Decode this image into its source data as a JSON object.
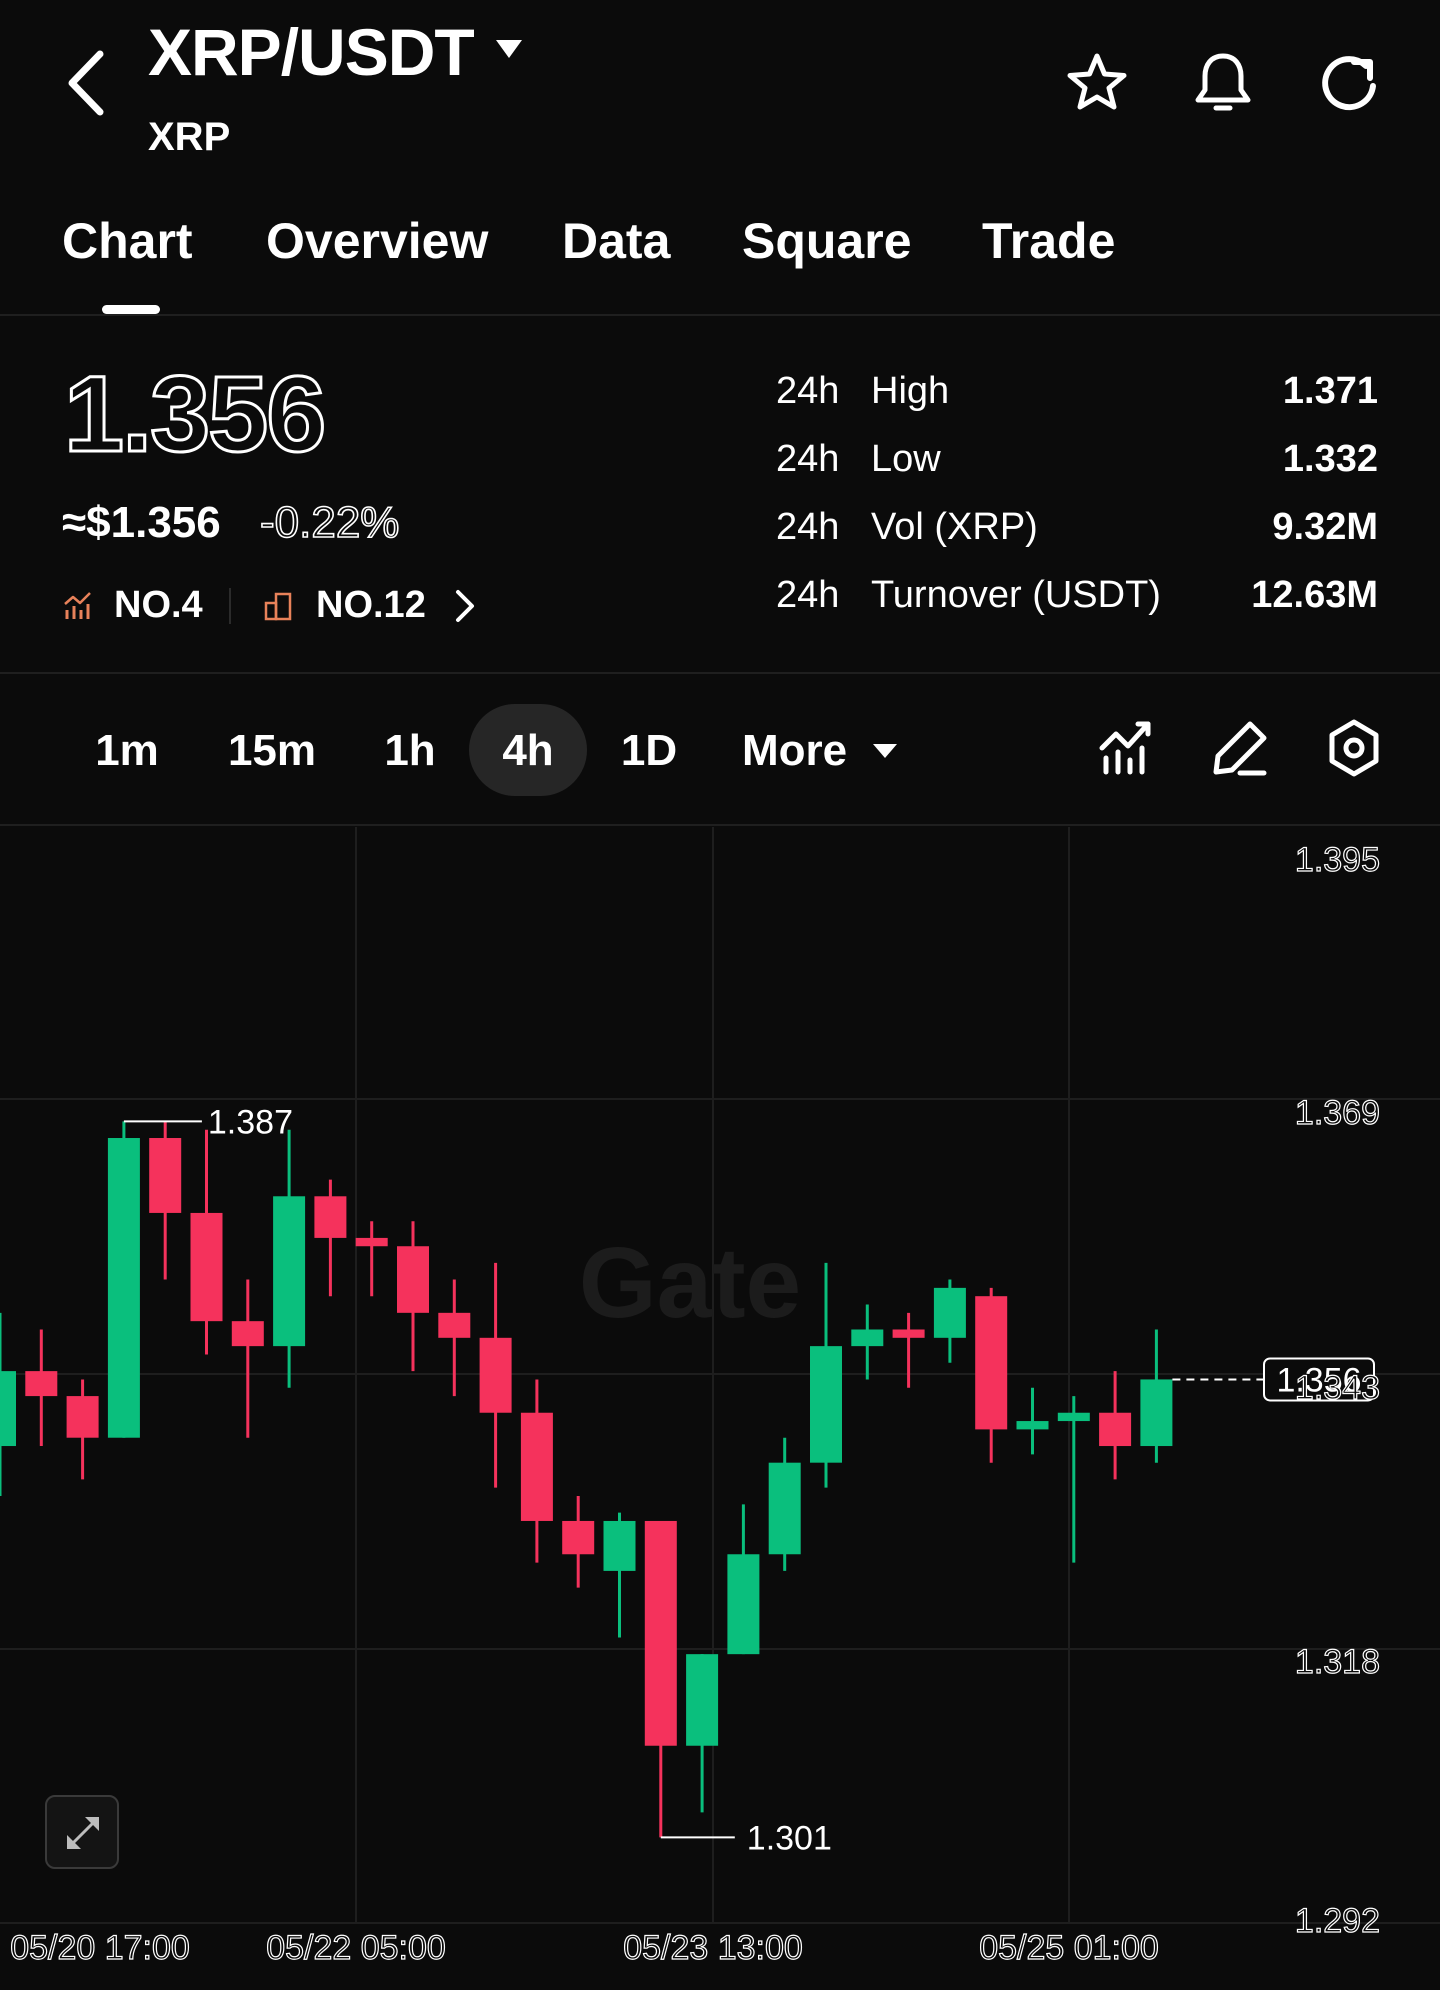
{
  "header": {
    "title": "XRP/USDT",
    "subtitle": "XRP",
    "icons": [
      "back-icon",
      "chevron-down-icon",
      "star-icon",
      "bell-icon",
      "refresh-icon"
    ]
  },
  "tabs": [
    {
      "label": "Chart",
      "active": true
    },
    {
      "label": "Overview",
      "active": false
    },
    {
      "label": "Data",
      "active": false
    },
    {
      "label": "Square",
      "active": false
    },
    {
      "label": "Trade",
      "active": false
    }
  ],
  "price": {
    "last": "1.356",
    "usd": "≈$1.356",
    "change": "-0.22%",
    "rank_market_cap": "NO.4",
    "rank_volume": "NO.12"
  },
  "stats": [
    {
      "period": "24h",
      "label": "High",
      "value": "1.371"
    },
    {
      "period": "24h",
      "label": "Low",
      "value": "1.332"
    },
    {
      "period": "24h",
      "label": "Vol (XRP)",
      "value": "9.32M"
    },
    {
      "period": "24h",
      "label": "Turnover (USDT)",
      "value": "12.63M"
    }
  ],
  "intervals": {
    "items": [
      "1m",
      "15m",
      "1h",
      "4h",
      "1D"
    ],
    "selected": "4h",
    "more_label": "More"
  },
  "toolbar_icons": [
    "indicators-icon",
    "draw-icon",
    "settings-icon"
  ],
  "colors": {
    "background": "#0b0b0b",
    "up": "#0abf7d",
    "down": "#f5325c",
    "text": "#ffffff",
    "grid": "#1e1e1e"
  },
  "chart_data": {
    "type": "candlestick",
    "interval": "4h",
    "watermark": "Gate",
    "y_ticks": [
      "1.395",
      "1.369",
      "1.343",
      "1.318",
      "1.292"
    ],
    "ylim": [
      1.292,
      1.395
    ],
    "x_ticks": [
      "05/20 17:00",
      "05/22 05:00",
      "05/23 13:00",
      "05/25 01:00"
    ],
    "max_label": "1.387",
    "min_label": "1.301",
    "last_price_label": "1.356",
    "candles": [
      {
        "o": 1.348,
        "h": 1.364,
        "l": 1.342,
        "c": 1.357
      },
      {
        "o": 1.357,
        "h": 1.362,
        "l": 1.348,
        "c": 1.354
      },
      {
        "o": 1.354,
        "h": 1.356,
        "l": 1.344,
        "c": 1.349
      },
      {
        "o": 1.349,
        "h": 1.387,
        "l": 1.349,
        "c": 1.385
      },
      {
        "o": 1.385,
        "h": 1.387,
        "l": 1.368,
        "c": 1.376
      },
      {
        "o": 1.376,
        "h": 1.386,
        "l": 1.359,
        "c": 1.363
      },
      {
        "o": 1.363,
        "h": 1.368,
        "l": 1.349,
        "c": 1.36
      },
      {
        "o": 1.36,
        "h": 1.386,
        "l": 1.355,
        "c": 1.378
      },
      {
        "o": 1.378,
        "h": 1.38,
        "l": 1.366,
        "c": 1.373
      },
      {
        "o": 1.373,
        "h": 1.375,
        "l": 1.366,
        "c": 1.372
      },
      {
        "o": 1.372,
        "h": 1.375,
        "l": 1.357,
        "c": 1.364
      },
      {
        "o": 1.364,
        "h": 1.368,
        "l": 1.354,
        "c": 1.361
      },
      {
        "o": 1.361,
        "h": 1.37,
        "l": 1.343,
        "c": 1.352
      },
      {
        "o": 1.352,
        "h": 1.356,
        "l": 1.334,
        "c": 1.339
      },
      {
        "o": 1.339,
        "h": 1.342,
        "l": 1.331,
        "c": 1.335
      },
      {
        "o": 1.333,
        "h": 1.34,
        "l": 1.325,
        "c": 1.339
      },
      {
        "o": 1.339,
        "h": 1.339,
        "l": 1.301,
        "c": 1.312
      },
      {
        "o": 1.312,
        "h": 1.323,
        "l": 1.304,
        "c": 1.323
      },
      {
        "o": 1.323,
        "h": 1.341,
        "l": 1.323,
        "c": 1.335
      },
      {
        "o": 1.335,
        "h": 1.349,
        "l": 1.333,
        "c": 1.346
      },
      {
        "o": 1.346,
        "h": 1.37,
        "l": 1.343,
        "c": 1.36
      },
      {
        "o": 1.36,
        "h": 1.365,
        "l": 1.356,
        "c": 1.362
      },
      {
        "o": 1.362,
        "h": 1.364,
        "l": 1.355,
        "c": 1.361
      },
      {
        "o": 1.361,
        "h": 1.368,
        "l": 1.358,
        "c": 1.367
      },
      {
        "o": 1.366,
        "h": 1.367,
        "l": 1.346,
        "c": 1.35
      },
      {
        "o": 1.35,
        "h": 1.355,
        "l": 1.347,
        "c": 1.351
      },
      {
        "o": 1.351,
        "h": 1.354,
        "l": 1.334,
        "c": 1.352
      },
      {
        "o": 1.352,
        "h": 1.357,
        "l": 1.344,
        "c": 1.348
      },
      {
        "o": 1.348,
        "h": 1.362,
        "l": 1.346,
        "c": 1.356
      }
    ]
  }
}
